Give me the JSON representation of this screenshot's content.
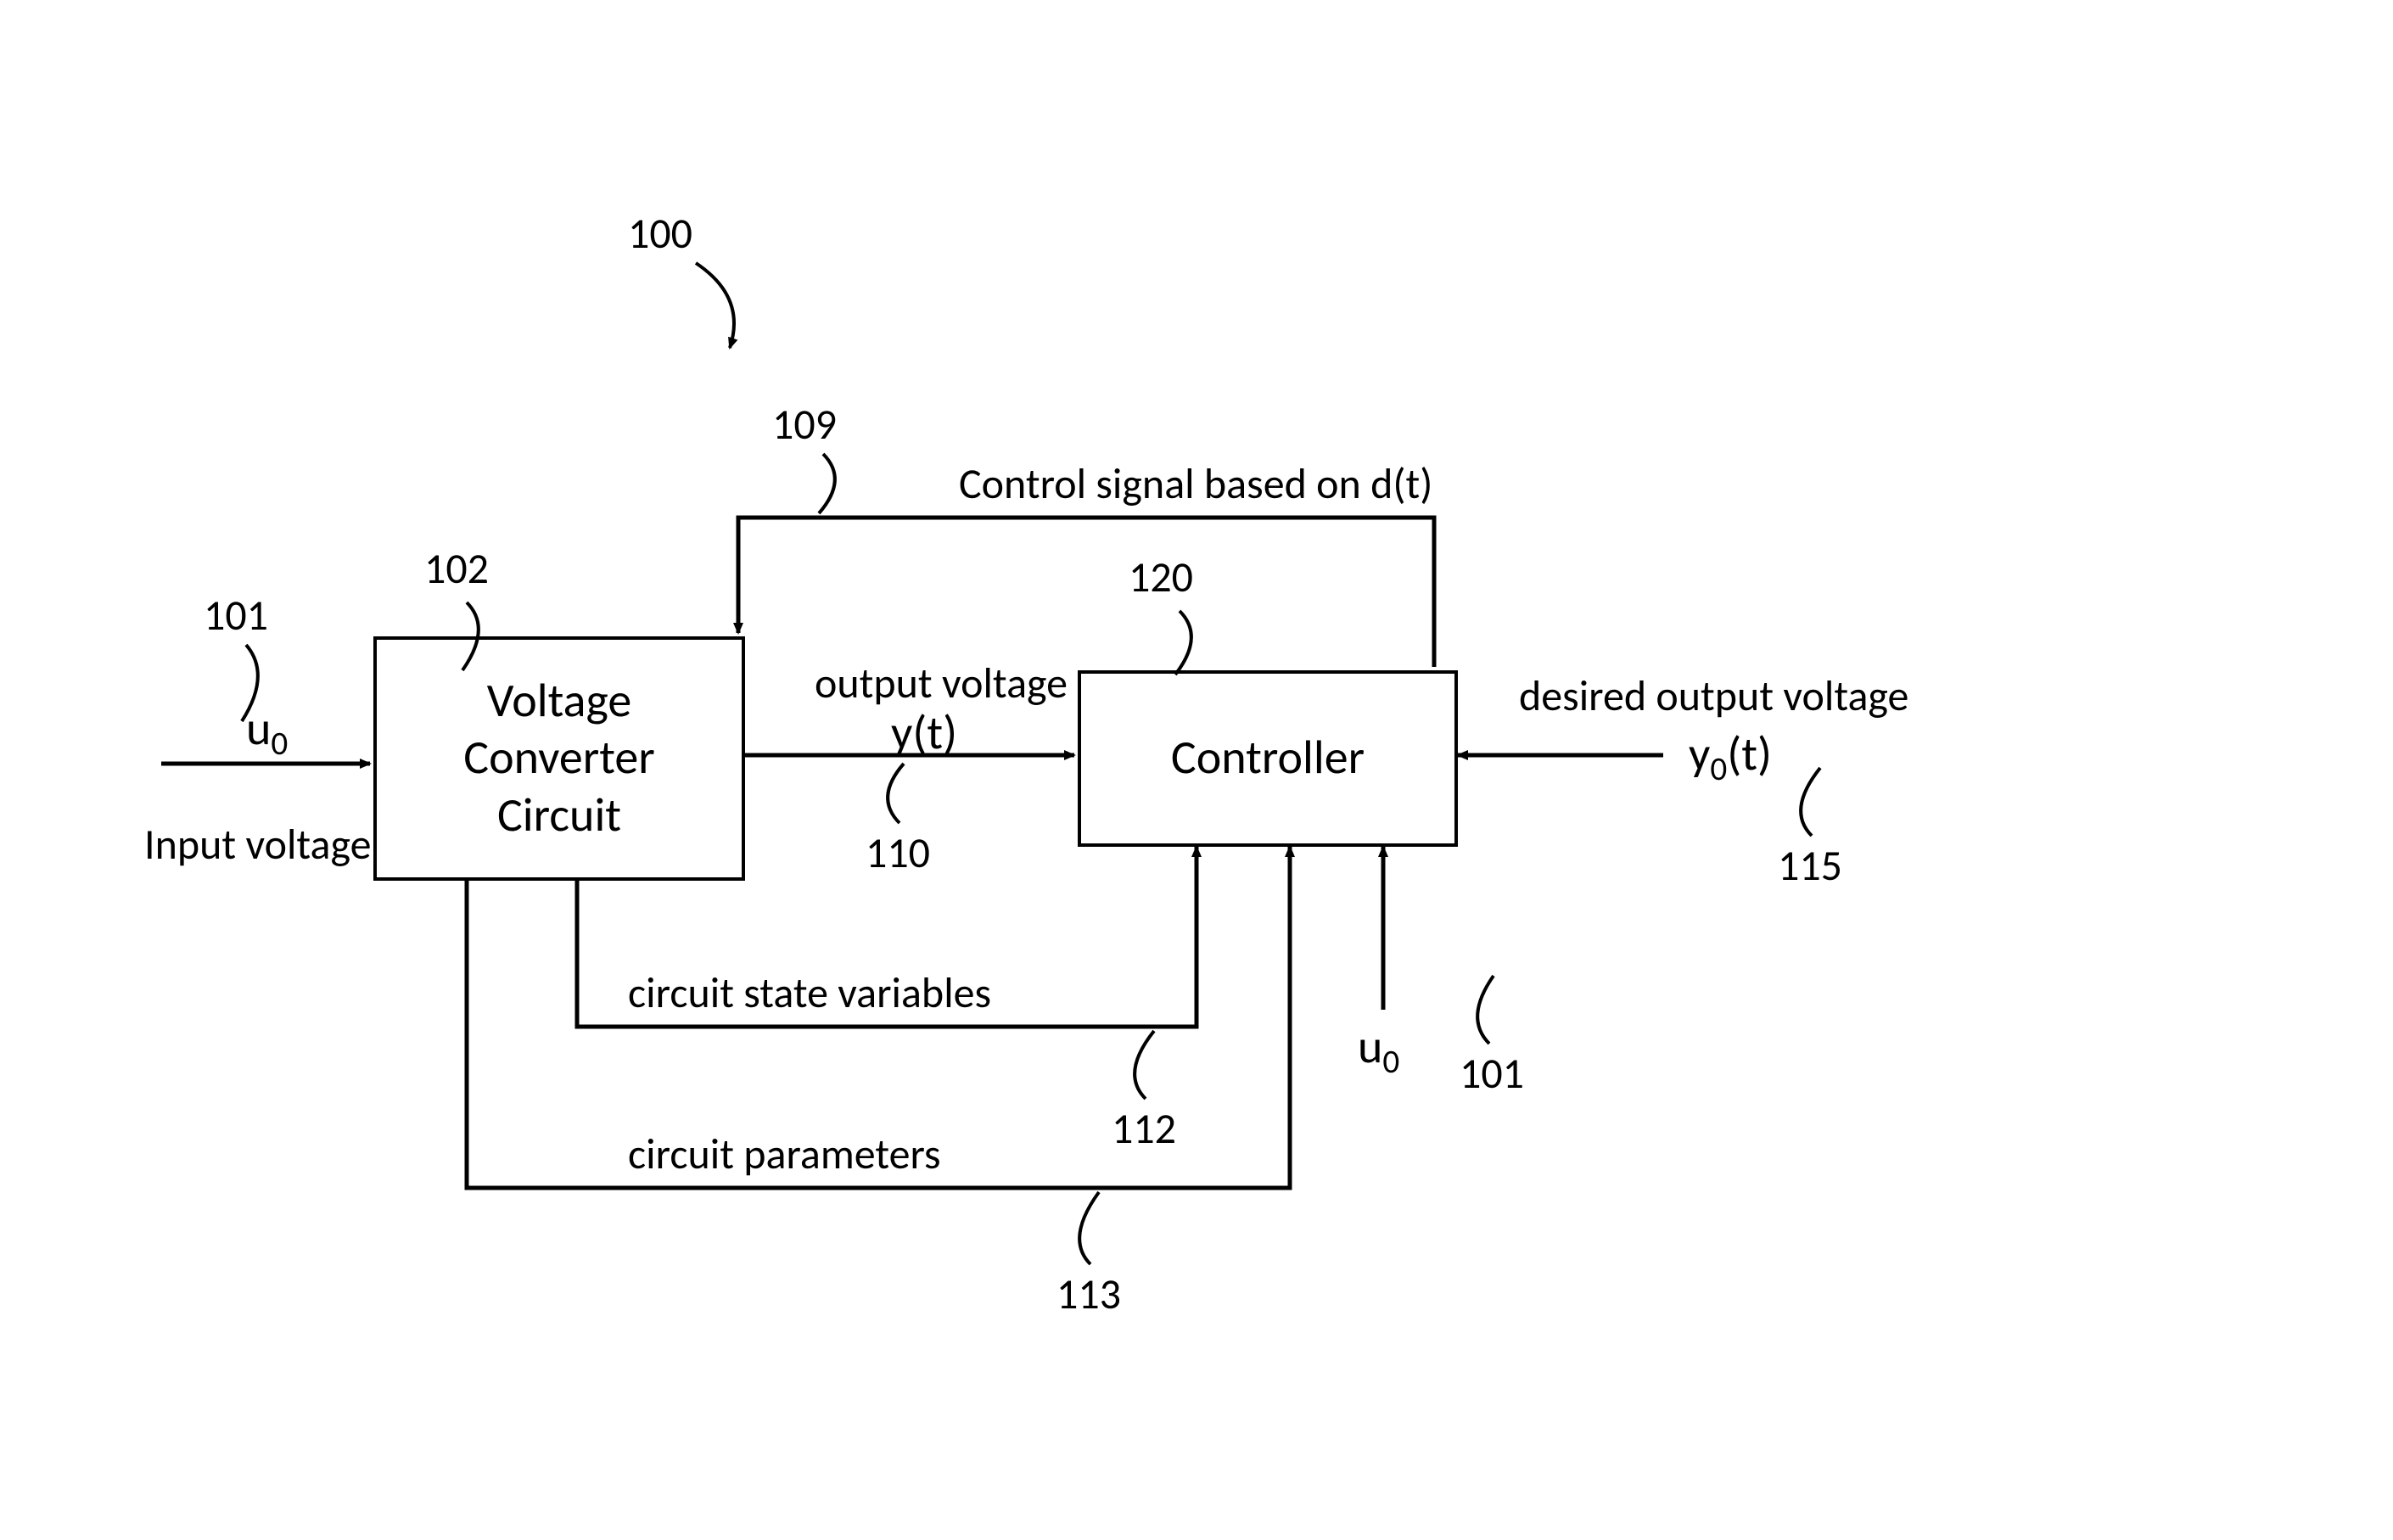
{
  "refs": {
    "r100": "100",
    "r101a": "101",
    "r101b": "101",
    "r102": "102",
    "r109": "109",
    "r110": "110",
    "r112": "112",
    "r113": "113",
    "r115": "115",
    "r120": "120"
  },
  "blocks": {
    "converter": "Voltage\nConverter\nCircuit",
    "controller": "Controller"
  },
  "labels": {
    "u0_left": "u",
    "u0_left_sub": "0",
    "input_voltage": "Input voltage",
    "output_voltage": "output voltage",
    "yt": "y(t)",
    "control_signal": "Control signal based on d(t)",
    "circuit_state": "circuit state variables",
    "circuit_params": "circuit parameters",
    "u0_bottom": "u",
    "u0_bottom_sub": "0",
    "desired_output": "desired output voltage",
    "y0t_pre": "y",
    "y0t_sub": "0",
    "y0t_post": "(t)"
  }
}
